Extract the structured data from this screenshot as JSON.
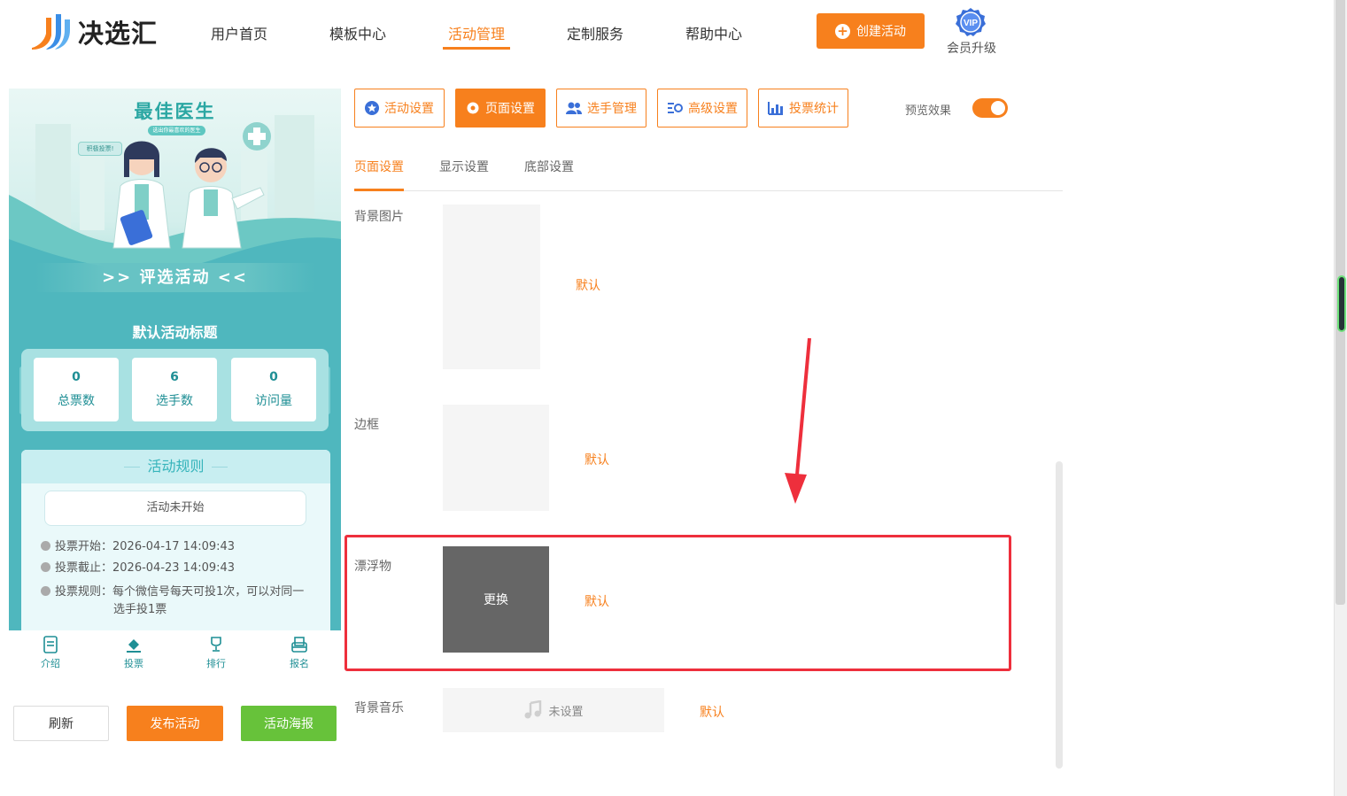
{
  "header": {
    "brand": "决选汇",
    "nav": [
      "用户首页",
      "模板中心",
      "活动管理",
      "定制服务",
      "帮助中心"
    ],
    "active_nav": "活动管理",
    "create_button": "创建活动",
    "vip_badge": "VIP",
    "vip_label": "会员升级",
    "accent_color": "#f7801d"
  },
  "preview": {
    "banner_title": "最佳医生",
    "banner_subtitle": "选出你最喜欢的医生",
    "banner_tag": "积极投票!",
    "banner_ribbon": ">> 评选活动 <<",
    "activity_title": "默认活动标题",
    "stats": [
      {
        "value": "0",
        "label": "总票数"
      },
      {
        "value": "6",
        "label": "选手数"
      },
      {
        "value": "0",
        "label": "访问量"
      }
    ],
    "rules_title": "活动规则",
    "status": "活动未开始",
    "vote_start": "投票开始：2026-04-17 14:09:43",
    "vote_end": "投票截止：2026-04-23 14:09:43",
    "vote_rule_1": "投票规则：每个微信号每天可投1次，可以对同一",
    "vote_rule_2": "选手投1票",
    "tabbar": [
      "介绍",
      "投票",
      "排行",
      "报名"
    ],
    "theme_color": "#4fb7be"
  },
  "bottom_buttons": {
    "refresh": "刷新",
    "publish": "发布活动",
    "poster": "活动海报"
  },
  "toolbar": {
    "buttons": [
      "活动设置",
      "页面设置",
      "选手管理",
      "高级设置",
      "投票统计"
    ],
    "active": "页面设置",
    "preview_label": "预览效果",
    "preview_on": true
  },
  "sub_tabs": {
    "items": [
      "页面设置",
      "显示设置",
      "底部设置"
    ],
    "active": "页面设置"
  },
  "settings": {
    "background_image": {
      "label": "背景图片",
      "default": "默认"
    },
    "border": {
      "label": "边框",
      "default": "默认"
    },
    "floater": {
      "label": "漂浮物",
      "replace": "更换",
      "default": "默认"
    },
    "music": {
      "label": "背景音乐",
      "value": "未设置",
      "default": "默认"
    },
    "highlight_color": "#ee2f3c"
  }
}
